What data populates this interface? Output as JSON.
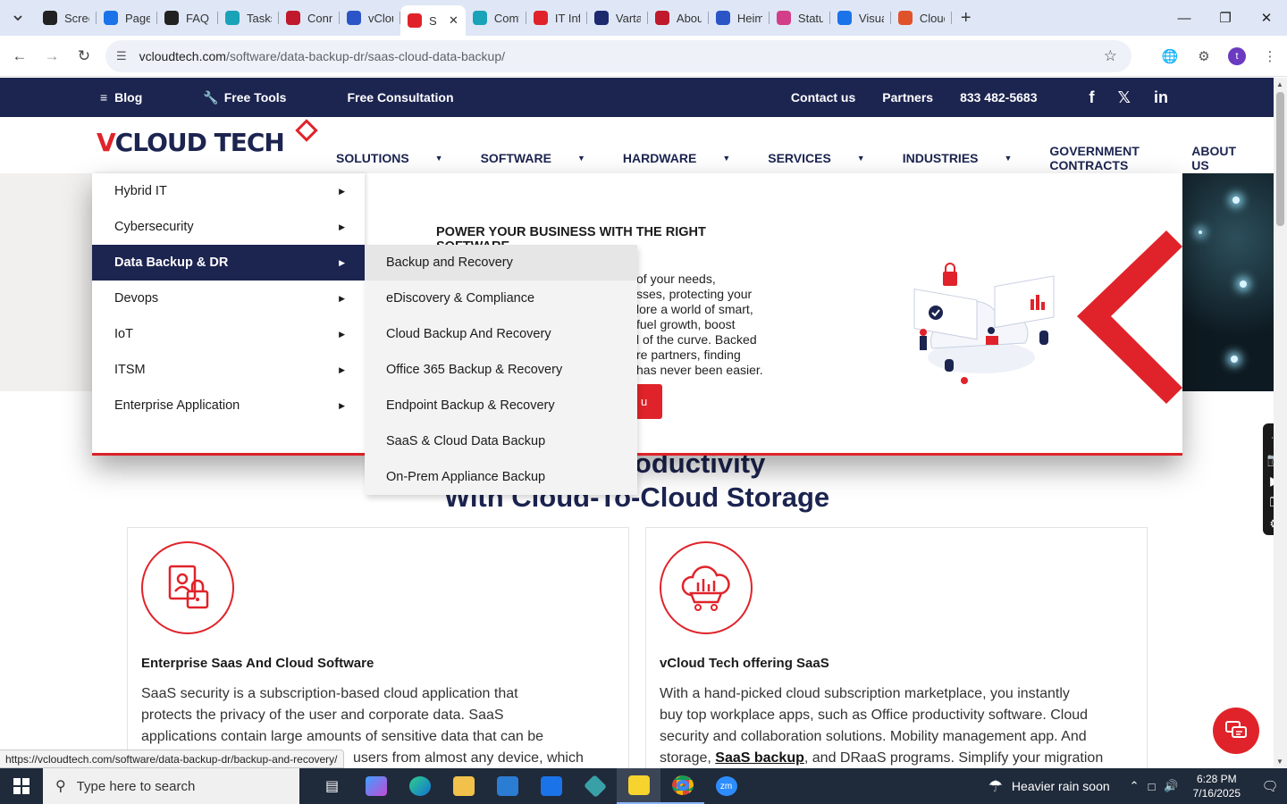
{
  "browser": {
    "tabs": [
      {
        "label": "Screen",
        "icon": "pinwheel-icon",
        "color": "#222222"
      },
      {
        "label": "PageS",
        "icon": "gauge-icon",
        "color": "#1a73e8"
      },
      {
        "label": "FAQ T",
        "icon": "o-icon",
        "color": "#222222"
      },
      {
        "label": "Tasks",
        "icon": "diamond-icon",
        "color": "#1aa3b8"
      },
      {
        "label": "Conn",
        "icon": "v-icon",
        "color": "#c0182c"
      },
      {
        "label": "vClou",
        "icon": "check-icon",
        "color": "#2b55c7"
      },
      {
        "label": "S",
        "icon": "vcloud-icon",
        "color": "#e0232a",
        "active": true
      },
      {
        "label": "Comt",
        "icon": "globe-icon",
        "color": "#1aa3b8"
      },
      {
        "label": "IT Infr",
        "icon": "vcloud-icon",
        "color": "#e0232a"
      },
      {
        "label": "Vartar",
        "icon": "x-icon",
        "color": "#1c2a6e"
      },
      {
        "label": "About",
        "icon": "abstract-icon",
        "color": "#c0182c"
      },
      {
        "label": "Heim",
        "icon": "scale-icon",
        "color": "#2b55c7"
      },
      {
        "label": "Status",
        "icon": "pen-icon",
        "color": "#d23f88"
      },
      {
        "label": "Visual",
        "icon": "pulse-icon",
        "color": "#1a73e8"
      },
      {
        "label": "Cloud",
        "icon": "swoosh-icon",
        "color": "#e0532a"
      }
    ],
    "url_host": "vcloudtech.com",
    "url_path": "/software/data-backup-dr/saas-cloud-data-backup/",
    "profile_initial": "t",
    "status_url": "https://vcloudtech.com/software/data-backup-dr/backup-and-recovery/"
  },
  "site": {
    "topbar": {
      "blog": "Blog",
      "free_tools": "Free Tools",
      "free_consultation": "Free Consultation",
      "contact": "Contact us",
      "partners": "Partners",
      "phone": "833 482-5683"
    },
    "logo": {
      "v": "V",
      "rest": "CLOUD TECH"
    },
    "nav": [
      {
        "label": "SOLUTIONS",
        "caret": true
      },
      {
        "label": "SOFTWARE",
        "caret": true
      },
      {
        "label": "HARDWARE",
        "caret": true
      },
      {
        "label": "SERVICES",
        "caret": true
      },
      {
        "label": "INDUSTRIES",
        "caret": true
      },
      {
        "label": "GOVERNMENT CONTRACTS",
        "caret": false
      },
      {
        "label": "ABOUT US",
        "caret": false
      }
    ],
    "mega": {
      "categories": [
        {
          "label": "Hybrid IT"
        },
        {
          "label": "Cybersecurity"
        },
        {
          "label": "Data Backup & DR",
          "active": true
        },
        {
          "label": "Devops"
        },
        {
          "label": "IoT"
        },
        {
          "label": "ITSM"
        },
        {
          "label": "Enterprise Application"
        }
      ],
      "submenu": [
        {
          "label": "Backup and Recovery",
          "hover": true
        },
        {
          "label": "eDiscovery & Compliance"
        },
        {
          "label": "Cloud Backup And Recovery"
        },
        {
          "label": "Office 365 Backup & Recovery"
        },
        {
          "label": "Endpoint Backup & Recovery"
        },
        {
          "label": "SaaS & Cloud Data Backup"
        },
        {
          "label": "On-Prem Appliance Backup"
        }
      ],
      "heading": "POWER YOUR BUSINESS WITH THE RIGHT SOFTWARE",
      "body_lines": [
        "of your needs,",
        "sses, protecting your",
        "lore a world of smart,",
        "fuel growth, boost",
        "l of the curve. Backed",
        "re partners, finding",
        "has never been easier."
      ],
      "button_fragment": "u"
    },
    "section_title_line1": "ational Productivity",
    "section_title_line2": "With Cloud-To-Cloud Storage",
    "cards": [
      {
        "title": "Enterprise Saas And Cloud Software",
        "lines": [
          "SaaS security is a subscription-based cloud application that",
          "protects the privacy of the user and corporate data. SaaS",
          "applications contain large amounts of sensitive data that can be",
          "users from almost any device, which"
        ]
      },
      {
        "title": "vCloud Tech offering SaaS",
        "lines": [
          "With a hand-picked cloud subscription marketplace, you instantly",
          "buy top workplace apps, such as Office productivity software. Cloud",
          "security and collaboration solutions. Mobility management app. And"
        ],
        "last_line_prefix": "storage, ",
        "link": "SaaS backup",
        "last_line_suffix": ", and DRaaS programs. Simplify your migration"
      }
    ]
  },
  "taskbar": {
    "search_placeholder": "Type here to search",
    "weather": "Heavier rain soon",
    "time": "6:28 PM",
    "date": "7/16/2025"
  },
  "colors": {
    "brand_navy": "#1c2450",
    "brand_red": "#e0232a"
  }
}
